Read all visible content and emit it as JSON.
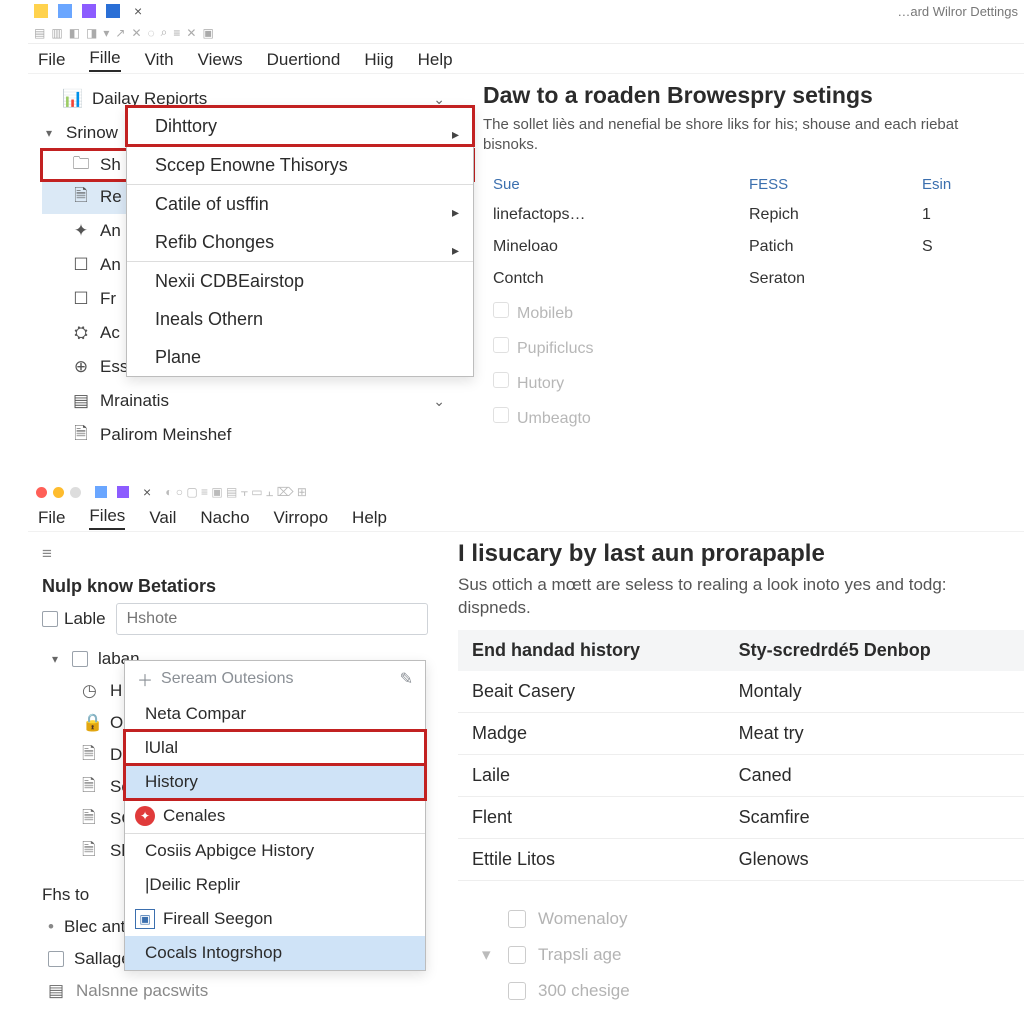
{
  "panel1": {
    "toolbar_hint": "…ard Wilror Dettings",
    "menubar": [
      "File",
      "Fille",
      "Vith",
      "Views",
      "Duertiond",
      "Hiig",
      "Help"
    ],
    "open_menu_index": 1,
    "sidebar": {
      "root": {
        "label": "Dailay Repiorts"
      },
      "group_open": {
        "label": "Srinow"
      },
      "items": [
        {
          "label": "Sh"
        },
        {
          "label": "Re",
          "selected": true
        },
        {
          "label": "An"
        },
        {
          "label": "An"
        },
        {
          "label": "Fr"
        },
        {
          "label": "Ac"
        },
        {
          "label": "Essory",
          "chev": "up"
        },
        {
          "label": "Mrainatis",
          "chev": "down"
        },
        {
          "label": "Palirom Meinshef"
        }
      ]
    },
    "dropdown": [
      {
        "label": "Dihttory",
        "submenu": true,
        "highlight": true
      },
      {
        "sep": true
      },
      {
        "label": "Sccep Enowne Thisorys"
      },
      {
        "sep": true
      },
      {
        "label": "Catile of usffin",
        "submenu": true
      },
      {
        "label": "Refib Chonges",
        "submenu": true
      },
      {
        "sep": true
      },
      {
        "label": "Nexii CDBEairstop"
      },
      {
        "label": "Ineals Othern"
      },
      {
        "label": "Plane"
      }
    ],
    "content": {
      "title": "Daw to a roaden Browespry setings",
      "subtitle": "The sollet liès and nenefial be shore liks for his; shouse and each riebat bisnoks.",
      "columns": [
        "Sue",
        "FESS",
        "Esin"
      ],
      "rows": [
        {
          "c1": "linefactops…",
          "c2": "Repich",
          "c3": "1"
        },
        {
          "c1": "Mineloao",
          "c2": "Patich",
          "c3": "S"
        },
        {
          "c1": "Contch",
          "c2": "Seraton",
          "c3": ""
        }
      ],
      "dim_rows": [
        {
          "c1": "Mobileb"
        },
        {
          "c1": "Pupificlucs"
        },
        {
          "c1": "Hutory"
        },
        {
          "c1": "Umbeagto"
        }
      ]
    }
  },
  "panel2": {
    "menubar": [
      "File",
      "Files",
      "Vail",
      "Nacho",
      "Virropo",
      "Help"
    ],
    "open_menu_index": 1,
    "sidebar": {
      "heading": "Nulp know Betatiors",
      "label_text": "Lable",
      "search_placeholder": "Hshote",
      "group_label": "laban",
      "items": [
        {
          "ico": "clock",
          "label": "H"
        },
        {
          "ico": "lock",
          "label": "O"
        },
        {
          "ico": "doc",
          "label": "D"
        },
        {
          "ico": "doc",
          "label": "Sc"
        },
        {
          "ico": "doc",
          "label": "SG"
        },
        {
          "ico": "doc",
          "label": "Sk"
        }
      ],
      "footer_label": "Fhs to",
      "footer_items": [
        {
          "label": "Blec antars"
        },
        {
          "label": "Sallages"
        },
        {
          "label": "Nalsnne pacswits"
        }
      ]
    },
    "dropdown": {
      "head": "Seream Outesions",
      "items": [
        {
          "label": "Neta Compar"
        },
        {
          "label": "lUlal",
          "highlight": true
        },
        {
          "label": "History",
          "selected": true,
          "highlight": true
        },
        {
          "label": "Cenales",
          "ico": "red"
        },
        {
          "sep": true
        },
        {
          "label": "Cosiis Apbigce History"
        },
        {
          "label": "|Deilic Replir"
        },
        {
          "label": "Fireall Seegon",
          "ico": "blue"
        },
        {
          "label": "Cocals Intogrshop",
          "selected": true
        }
      ]
    },
    "content": {
      "title": "I lisucary by last aun prorapaple",
      "subtitle": "Sus ottich a mœtt are seless to realing a look inoto yes and todg: dispneds.",
      "columns": [
        "End handad history",
        "Sty-scredrdé5 Denbop"
      ],
      "rows": [
        {
          "c1": "Beait Casery",
          "c2": "Montaly"
        },
        {
          "c1": "Madge",
          "c2": "Meat try"
        },
        {
          "c1": "Laile",
          "c2": "Caned"
        },
        {
          "c1": "Flent",
          "c2": "Scamfire"
        },
        {
          "c1": "Ettile Litos",
          "c2": "Glenows"
        }
      ],
      "faint": [
        "Womenaloy",
        "Trapsli age",
        "300 chesige"
      ]
    }
  }
}
